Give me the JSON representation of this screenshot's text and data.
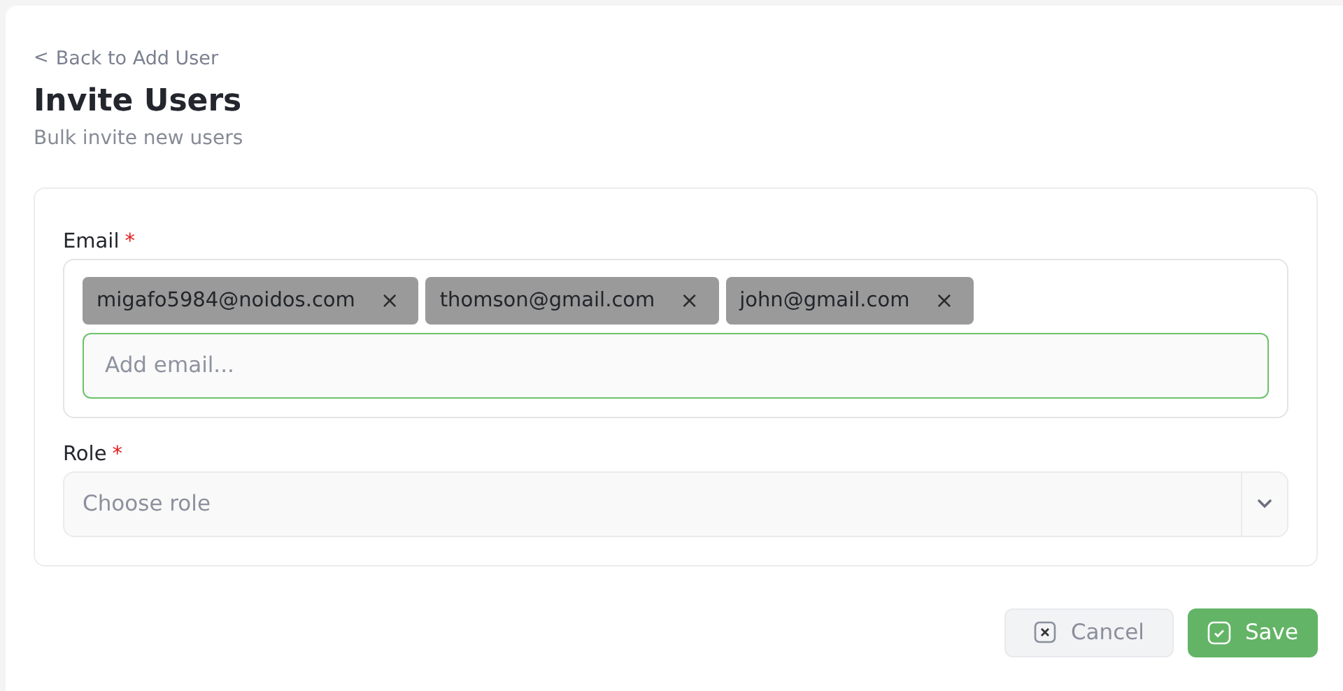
{
  "back_link": {
    "icon": "<",
    "label": "Back to Add User"
  },
  "title": "Invite Users",
  "subtitle": "Bulk invite new users",
  "email_field": {
    "label": "Email",
    "required_mark": "*",
    "chips": [
      {
        "label": "migafo5984@noidos.com",
        "remove": "×"
      },
      {
        "label": "thomson@gmail.com",
        "remove": "×"
      },
      {
        "label": "john@gmail.com",
        "remove": "×"
      }
    ],
    "input": {
      "placeholder": "Add email...",
      "focused": true
    }
  },
  "role_field": {
    "label": "Role",
    "required_mark": "*",
    "placeholder": "Choose role"
  },
  "buttons": [
    {
      "kind": "cancel",
      "label": "Cancel"
    },
    {
      "kind": "save",
      "label": "Save"
    }
  ]
}
